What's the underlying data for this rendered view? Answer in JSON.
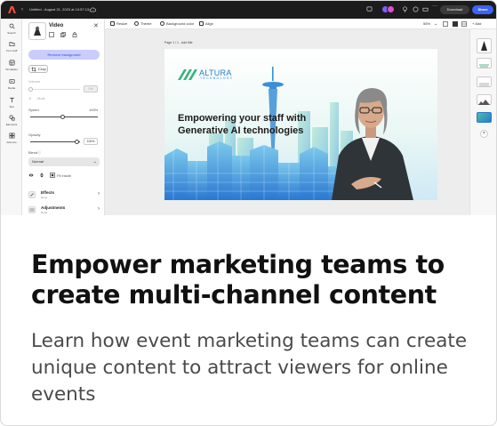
{
  "app": {
    "document_title": "Untitled - August 21, 2023 at 10:57:13",
    "download_label": "Download",
    "share_label": "Share",
    "brand_color": "#3b63fb"
  },
  "left_rail": {
    "items": [
      {
        "label": "Search",
        "icon": "search-icon"
      },
      {
        "label": "Your stuff",
        "icon": "folder-icon"
      },
      {
        "label": "Templates",
        "icon": "templates-icon"
      },
      {
        "label": "Media",
        "icon": "media-icon"
      },
      {
        "label": "Text",
        "icon": "text-icon"
      },
      {
        "label": "Elements",
        "icon": "elements-icon"
      },
      {
        "label": "Add-ons",
        "icon": "addons-icon"
      }
    ]
  },
  "panel": {
    "title": "Video",
    "close_glyph": "✕",
    "remove_background_label": "Remove background",
    "crop_label": "Crop",
    "volume_label": "Volume",
    "volume_value": "0%",
    "mute_label": "Mute",
    "speed_label": "Speed",
    "speed_value": "100%",
    "opacity_label": "Opacity",
    "opacity_value": "100%",
    "blend_label": "Blend",
    "blend_value": "Normal",
    "fit_inside_label": "Fit inside",
    "effects_title": "Effects",
    "effects_sub": "None",
    "adjustments_title": "Adjustments",
    "adjustments_sub": "None"
  },
  "toolbar": {
    "resize_label": "Resize",
    "theme_label": "Theme",
    "background_color_label": "Background color",
    "align_label": "Align",
    "zoom_value": "55%",
    "add_label": "Add"
  },
  "page": {
    "label": "Page 1 / 1 - Add title",
    "brand_name": "ALTURA",
    "brand_sub": "TECHNOLOGY",
    "headline_line1": "Empowering your staff with",
    "headline_line2": "Generative AI technologies"
  },
  "article": {
    "heading": "Empower marketing teams to create multi-channel content",
    "body": "Learn how event marketing teams can create unique content to attract viewers for online events"
  }
}
